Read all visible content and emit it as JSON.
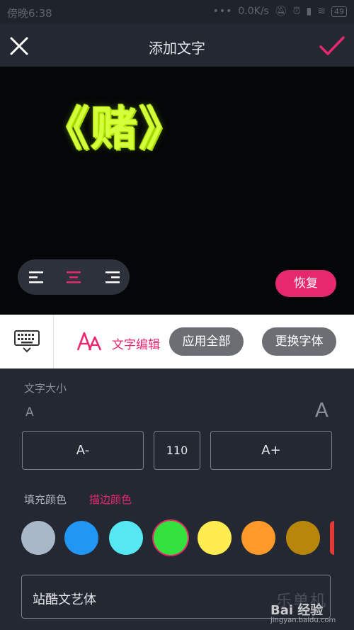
{
  "status_bar": {
    "time": "傍晚6:38",
    "net_speed": "0.0K/s",
    "battery": "49"
  },
  "header": {
    "title": "添加文字",
    "close_icon": "close-icon",
    "confirm_icon": "check-icon",
    "confirm_color": "#e8286e"
  },
  "preview": {
    "text": "《赌》",
    "text_color": "#d4ff3a",
    "restore_label": "恢复",
    "align_options": [
      "align-left",
      "align-center",
      "align-right"
    ],
    "align_selected": "align-center"
  },
  "toolbar": {
    "keyboard_icon": "keyboard-icon",
    "style_icon": "text-style-icon",
    "edit_label": "文字编辑",
    "apply_all_label": "应用全部",
    "change_font_label": "更换字体"
  },
  "size": {
    "label": "文字大小",
    "small_a": "A",
    "big_a": "A",
    "decrease_label": "A-",
    "value": "110",
    "increase_label": "A+"
  },
  "color": {
    "fill_tab": "填充颜色",
    "stroke_tab": "描边颜色",
    "active_tab": "stroke",
    "swatches": [
      "#a9b8c8",
      "#2196f3",
      "#55e8f2",
      "#33e23d",
      "#ffec50",
      "#ff9a2a",
      "#b8860b",
      "#e53935"
    ],
    "selected_index": 3
  },
  "font": {
    "name": "站酷文艺体"
  },
  "watermark": {
    "cn": "乐单机",
    "brand": "Bai 经验",
    "url": "jingyan.baidu.com"
  }
}
